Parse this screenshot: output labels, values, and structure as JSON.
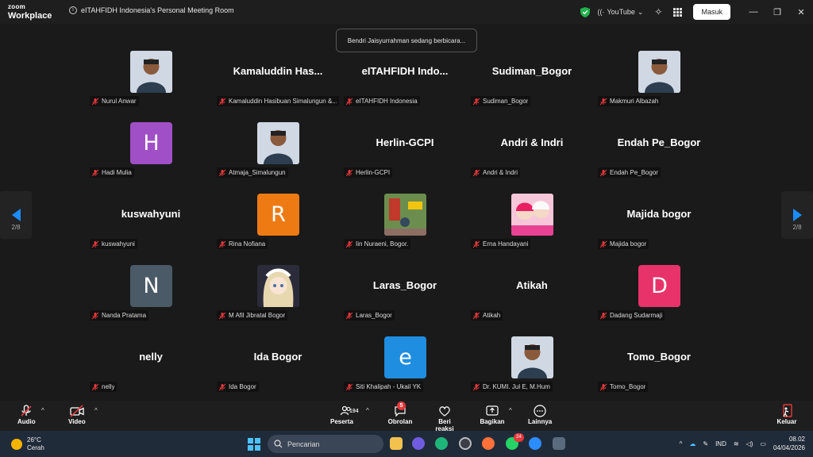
{
  "app": {
    "brand_top": "zoom",
    "brand_bottom": "Workplace",
    "meeting_title": "eITAHFIDH Indonesia's Personal Meeting Room",
    "youtube_label": "YouTube",
    "sign_in_label": "Masuk"
  },
  "toast": "Bendri Jaisyurrahman sedang berbicara...",
  "pager": {
    "left": "2/8",
    "right": "2/8"
  },
  "tile_colors": {
    "purple": "#a04fc6",
    "orange": "#ee7a14",
    "slate": "#4a5a66",
    "pink": "#e8336a",
    "blue": "#1f8ee0"
  },
  "participants": [
    {
      "label": "Nurul Anwar",
      "kind": "photo",
      "icon": "person-photo"
    },
    {
      "label": "Kamaluddin Hasibuan Simalungun &...",
      "kind": "name",
      "display": "Kamaluddin  Has..."
    },
    {
      "label": "eITAHFIDH Indonesia",
      "kind": "name",
      "display": "eITAHFIDH  Indo..."
    },
    {
      "label": "Sudiman_Bogor",
      "kind": "name",
      "display": "Sudiman_Bogor"
    },
    {
      "label": "Makmuri Albazah",
      "kind": "photo",
      "icon": "person-photo"
    },
    {
      "label": "Hadi Mulia",
      "kind": "letter",
      "letter": "H",
      "color": "purple"
    },
    {
      "label": "Atmaja_Simalungun",
      "kind": "photo",
      "icon": "person-photo"
    },
    {
      "label": "Herlin-GCPI",
      "kind": "name",
      "display": "Herlin-GCPI"
    },
    {
      "label": "Andri & Indri",
      "kind": "name",
      "display": "Andri & Indri"
    },
    {
      "label": "Endah Pe_Bogor",
      "kind": "name",
      "display": "Endah Pe_Bogor"
    },
    {
      "label": "kuswahyuni",
      "kind": "name",
      "display": "kuswahyuni"
    },
    {
      "label": "Rina Nofiana",
      "kind": "letter",
      "letter": "R",
      "color": "orange"
    },
    {
      "label": "Iin Nuraeni, Bogor.",
      "kind": "photo",
      "icon": "playground-photo"
    },
    {
      "label": "Erna Handayani",
      "kind": "photo",
      "icon": "children-photo"
    },
    {
      "label": "Majida bogor",
      "kind": "name",
      "display": "Majida bogor"
    },
    {
      "label": "Nanda Pratama",
      "kind": "letter",
      "letter": "N",
      "color": "slate"
    },
    {
      "label": "M Afil Jibratal Bogor",
      "kind": "photo",
      "icon": "anime-photo"
    },
    {
      "label": "Laras_Bogor",
      "kind": "name",
      "display": "Laras_Bogor"
    },
    {
      "label": "Atikah",
      "kind": "name",
      "display": "Atikah"
    },
    {
      "label": "Dadang Sudarmaji",
      "kind": "letter",
      "letter": "D",
      "color": "pink"
    },
    {
      "label": "nelly",
      "kind": "name",
      "display": "nelly"
    },
    {
      "label": "Ida Bogor",
      "kind": "name",
      "display": "Ida Bogor"
    },
    {
      "label": "Siti Khalipah - Ukail YK",
      "kind": "letter",
      "letter": "e",
      "color": "blue"
    },
    {
      "label": "Dr. KUMI. Jul E, M.Hum",
      "kind": "photo",
      "icon": "person-photo"
    },
    {
      "label": "Tomo_Bogor",
      "kind": "name",
      "display": "Tomo_Bogor"
    }
  ],
  "toolbar": {
    "audio": "Audio",
    "video": "Video",
    "participants": "Peserta",
    "participants_count": "194",
    "chat": "Obrolan",
    "chat_badge": "5",
    "reactions": "Beri reaksi",
    "share": "Bagikan",
    "more": "Lainnya",
    "leave": "Keluar"
  },
  "taskbar": {
    "temperature": "26°C",
    "weather": "Cerah",
    "search_placeholder": "Pencarian",
    "whatsapp_badge": "24",
    "language": "IND",
    "time": "08.02",
    "date": "04/04/2026"
  }
}
